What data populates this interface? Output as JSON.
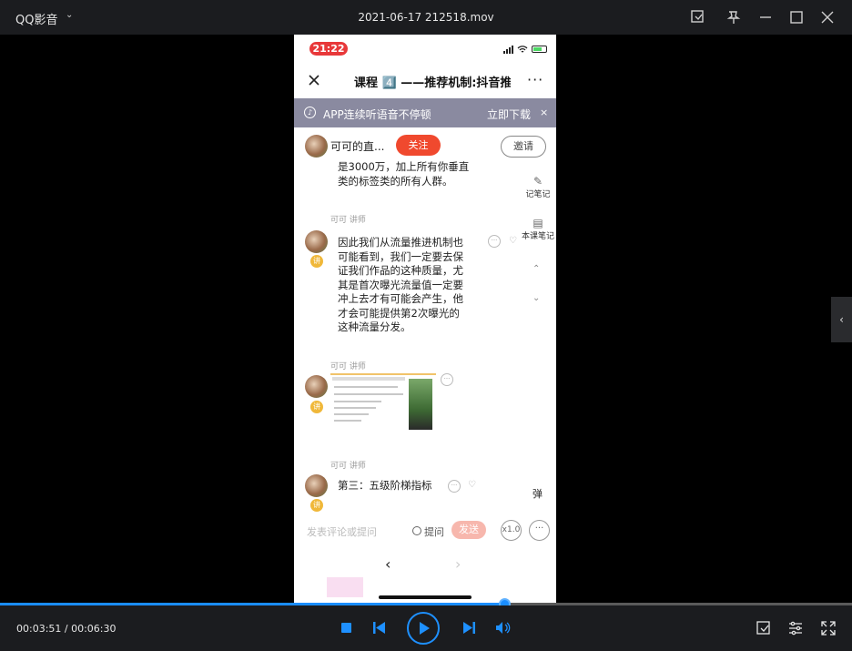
{
  "titlebar": {
    "app_name": "QQ影音",
    "file_name": "2021-06-17 212518.mov",
    "icons": [
      "screenshot-icon",
      "pin-icon",
      "minimize-icon",
      "maximize-icon",
      "close-icon"
    ]
  },
  "phone": {
    "status_time": "21:22",
    "nav_title": "课程 4️⃣ ——推荐机制:抖音推",
    "banner_text": "APP连续听语音不停顿",
    "banner_action": "立即下载",
    "banner_close": "×",
    "host_name": "可可的直...",
    "follow_label": "关注",
    "invite_label": "邀请",
    "messages": [
      {
        "lines": [
          "是3000万，加上所有你垂直",
          "类的标签类的所有人群。"
        ]
      },
      {
        "speaker": "可可 讲师",
        "lines": [
          "因此我们从流量推进机制也",
          "可能看到，我们一定要去保",
          "证我们作品的这种质量，尤",
          "其是首次曝光流量值一定要",
          "冲上去才有可能会产生，他",
          "才会可能提供第2次曝光的",
          "这种流量分发。"
        ]
      },
      {
        "speaker": "可可 讲师"
      },
      {
        "speaker": "可可 讲师",
        "lines": [
          "第三：五级阶梯指标"
        ]
      }
    ],
    "badge_label": "讲",
    "side_tools": [
      {
        "glyph": "✎",
        "label": "记笔记"
      },
      {
        "glyph": "▤",
        "label": "本课笔记"
      }
    ],
    "danmu_label": "弹",
    "comment_placeholder": "发表评论或提问",
    "ask_label": "提问",
    "send_label": "发送",
    "speed_label": "x1.0",
    "more_label": "···"
  },
  "player": {
    "current_time": "00:03:51",
    "total_time": "00:06:30",
    "timecode": "00:03:51 / 00:06:30",
    "progress_fraction": 0.592,
    "accent_color": "#1a8dff"
  }
}
